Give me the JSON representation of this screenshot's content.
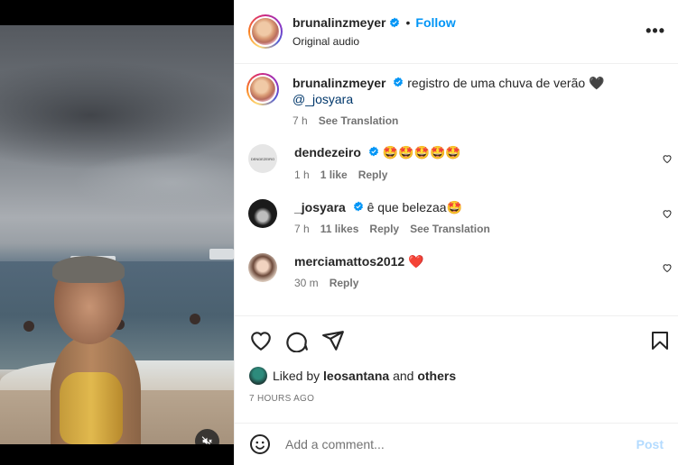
{
  "post": {
    "author": "brunalinzmeyer",
    "follow_label": "Follow",
    "audio": "Original audio",
    "separator": "•",
    "more_icon": "more-horizontal-icon"
  },
  "caption": {
    "author": "brunalinzmeyer",
    "text": "registro de uma chuva de verão 🖤",
    "mention": "@_josyara",
    "age": "7 h",
    "translate_label": "See Translation"
  },
  "comments": [
    {
      "author": "dendezeiro",
      "avatar_text": "DENDEZEIRO",
      "text": "🤩🤩🤩🤩🤩",
      "age": "1 h",
      "likes": "1 like",
      "reply_label": "Reply",
      "translate_label": ""
    },
    {
      "author": "_josyara",
      "avatar_text": "",
      "text": "ê que belezaa🤩",
      "age": "7 h",
      "likes": "11 likes",
      "reply_label": "Reply",
      "translate_label": "See Translation"
    },
    {
      "author": "merciamattos2012",
      "avatar_text": "",
      "text": "❤️",
      "age": "30 m",
      "likes": "",
      "reply_label": "Reply",
      "translate_label": ""
    }
  ],
  "engagement": {
    "liked_prefix": "Liked by",
    "liked_user": "leosantana",
    "liked_and": "and",
    "liked_others": "others",
    "timestamp": "7 HOURS AGO"
  },
  "composer": {
    "placeholder": "Add a comment...",
    "post_label": "Post"
  },
  "colors": {
    "accent": "#0095f6",
    "post_disabled": "#b3dbff",
    "muted": "#737373",
    "verified": "#0095f6",
    "heart_red": "#ed4956"
  }
}
